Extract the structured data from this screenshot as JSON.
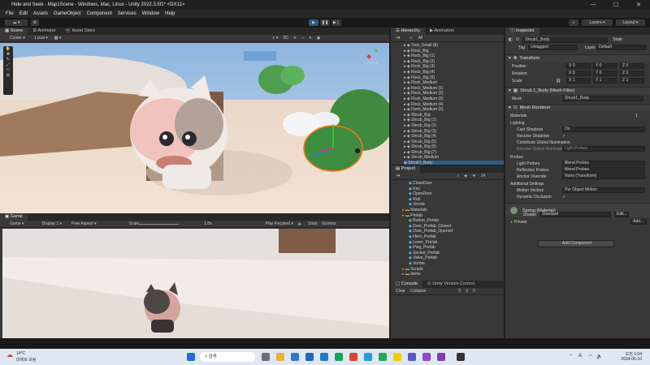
{
  "window": {
    "title": "Hide and Seek - Map1Scene - Windows, Mac, Linux - Unity 2022.3.5f1* <DX11>",
    "minimize": "—",
    "maximize": "☐",
    "close": "✕"
  },
  "menu": [
    "File",
    "Edit",
    "Assets",
    "GameObject",
    "Component",
    "Services",
    "Window",
    "Help"
  ],
  "toolbar": {
    "layers": "Layers",
    "layout": "Layout"
  },
  "scene": {
    "tabs": [
      "Scene",
      "Animator",
      "Asset Store"
    ],
    "pivot": "Center",
    "space": "Local",
    "persp": "< Persp"
  },
  "game": {
    "tab": "Game",
    "mode": "Game",
    "display": "Display 1",
    "aspect": "Free Aspect",
    "scale_label": "Scale",
    "scale_value": "1.8x",
    "play_focused": "Play Focused",
    "stats": "Stats",
    "gizmos": "Gizmos"
  },
  "hierarchy": {
    "tabs": [
      "Hierarchy",
      "Animation"
    ],
    "search_placeholder": "All",
    "items": [
      "Tree_Small (8)",
      "Rock_Big",
      "Rock_Big (1)",
      "Rock_Big (2)",
      "Rock_Big (3)",
      "Rock_Big (4)",
      "Rock_Big (5)",
      "Rock_Medium",
      "Rock_Medium (1)",
      "Rock_Medium (2)",
      "Rock_Medium (3)",
      "Rock_Medium (4)",
      "Rock_Medium (5)",
      "Shrub_Big",
      "Shrub_Big (1)",
      "Shrub_Big (2)",
      "Shrub_Big (3)",
      "Shrub_Big (4)",
      "Shrub_Big (5)",
      "Shrub_Big (6)",
      "Shrub_Big (7)",
      "Shrub_Medium",
      "Shrub1_Body"
    ],
    "selected": 22
  },
  "project": {
    "tab": "Project",
    "count": "14",
    "items": [
      "CloseDoor",
      "Key",
      "OpenDoor",
      "Rub",
      "Vorota",
      "Materials",
      "Prefab",
      "Button_Prefab",
      "Door_Prefab_Closed",
      "Door_Prefab_Opened",
      "Hero_Prefab",
      "Lever_Prefab",
      "Plug_Prefab",
      "Socket_Prefab",
      "Valve_Prefab",
      "Vorota",
      "Scripts",
      "demo"
    ]
  },
  "console": {
    "tabs": [
      "Console",
      "Unity Version Control"
    ],
    "clear": "Clear",
    "collapse": "Collapse",
    "errors": "0",
    "warnings": "0",
    "logs": "0"
  },
  "inspector": {
    "tab": "Inspector",
    "object_name": "Shrub1_Body",
    "static": "Static",
    "tag_label": "Tag",
    "tag": "Untagged",
    "layer_label": "Layer",
    "layer": "Default",
    "transform": "Transform",
    "position_label": "Position",
    "rotation_label": "Rotation",
    "scale_label": "Scale",
    "position": [
      "X 0",
      "Y 0",
      "Z 0"
    ],
    "rotation": [
      "X 0",
      "Y 0",
      "Z 0"
    ],
    "scale": [
      "X 1",
      "Y 1",
      "Z 1"
    ],
    "mesh_filter": "Shrub 1_Body (Mesh Filter)",
    "mesh_label": "Mesh",
    "mesh": "Shrub1_Body",
    "mesh_renderer": "Mesh Renderer",
    "materials": "Materials",
    "materials_count": "1",
    "lighting": "Lighting",
    "cast_shadows_label": "Cast Shadows",
    "cast_shadows": "On",
    "receive_shadows_label": "Receive Shadows",
    "contribute_gi_label": "Contribute Global Illumination",
    "receive_gi_label": "Receive Global Illumination",
    "receive_gi": "Light Probes",
    "probes": "Probes",
    "light_probes_label": "Light Probes",
    "light_probes": "Blend Probes",
    "reflection_probes_label": "Reflection Probes",
    "reflection_probes": "Blend Probes",
    "anchor_label": "Anchor Override",
    "anchor": "None (Transform)",
    "additional": "Additional Settings",
    "motion_label": "Motion Vectors",
    "motion": "Per Object Motion",
    "dynamic_label": "Dynamic Occlusion",
    "material_name": "Spring (Material)",
    "shader_label": "Shader",
    "shader": "Standard",
    "edit": "Edit...",
    "private": "Private",
    "add": "Add...",
    "add_component": "Add Component"
  },
  "taskbar": {
    "weather_temp": "14°C",
    "weather_text": "대체로 흐림",
    "search": "검색",
    "lang": "A",
    "time": "오전 1:04",
    "date": "2024-05-10"
  }
}
